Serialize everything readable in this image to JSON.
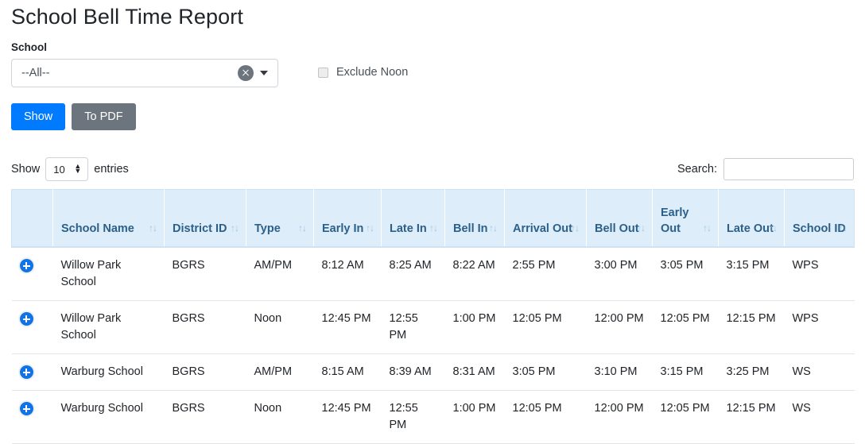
{
  "page_title": "School Bell Time Report",
  "filters": {
    "school_label": "School",
    "school_value": "--All--",
    "clear_icon": "circle-x-icon",
    "dropdown_icon": "caret-down-icon",
    "exclude_noon_label": "Exclude Noon",
    "exclude_noon_checked": false
  },
  "buttons": {
    "show": "Show",
    "to_pdf": "To PDF",
    "primary_color": "#007bff",
    "secondary_color": "#6c757d"
  },
  "datatable_controls": {
    "show_prefix": "Show",
    "page_length": "10",
    "entries_suffix": "entries",
    "search_label": "Search:",
    "search_value": "",
    "search_placeholder": ""
  },
  "table": {
    "header_bg": "#ddedf9",
    "header_color": "#2c6089",
    "sort_glyph": "↑↓",
    "columns": [
      {
        "label": "",
        "sortable": false
      },
      {
        "label": "School Name",
        "sortable": true
      },
      {
        "label": "District ID",
        "sortable": true
      },
      {
        "label": "Type",
        "sortable": true
      },
      {
        "label": "Early In",
        "sortable": true
      },
      {
        "label": "Late In",
        "sortable": true
      },
      {
        "label": "Bell In",
        "sortable": true
      },
      {
        "label": "Arrival Out",
        "sortable": true
      },
      {
        "label": "Bell Out",
        "sortable": true
      },
      {
        "label": "Early Out",
        "sortable": true
      },
      {
        "label": "Late Out",
        "sortable": true
      },
      {
        "label": "School ID",
        "sortable": true
      }
    ],
    "rows": [
      {
        "expand_icon": "plus-circle-icon",
        "school_name": "Willow Park School",
        "district_id": "BGRS",
        "type": "AM/PM",
        "early_in": "8:12 AM",
        "late_in": "8:25 AM",
        "bell_in": "8:22 AM",
        "arrival_out": "2:55 PM",
        "bell_out": "3:00 PM",
        "early_out": "3:05 PM",
        "late_out": "3:15 PM",
        "school_id": "WPS"
      },
      {
        "expand_icon": "plus-circle-icon",
        "school_name": "Willow Park School",
        "district_id": "BGRS",
        "type": "Noon",
        "early_in": "12:45 PM",
        "late_in": "12:55 PM",
        "bell_in": "1:00 PM",
        "arrival_out": "12:05 PM",
        "bell_out": "12:00 PM",
        "early_out": "12:05 PM",
        "late_out": "12:15 PM",
        "school_id": "WPS"
      },
      {
        "expand_icon": "plus-circle-icon",
        "school_name": "Warburg School",
        "district_id": "BGRS",
        "type": "AM/PM",
        "early_in": "8:15 AM",
        "late_in": "8:39 AM",
        "bell_in": "8:31 AM",
        "arrival_out": "3:05 PM",
        "bell_out": "3:10 PM",
        "early_out": "3:15 PM",
        "late_out": "3:25 PM",
        "school_id": "WS"
      },
      {
        "expand_icon": "plus-circle-icon",
        "school_name": "Warburg School",
        "district_id": "BGRS",
        "type": "Noon",
        "early_in": "12:45 PM",
        "late_in": "12:55 PM",
        "bell_in": "1:00 PM",
        "arrival_out": "12:05 PM",
        "bell_out": "12:00 PM",
        "early_out": "12:05 PM",
        "late_out": "12:15 PM",
        "school_id": "WS"
      }
    ]
  }
}
